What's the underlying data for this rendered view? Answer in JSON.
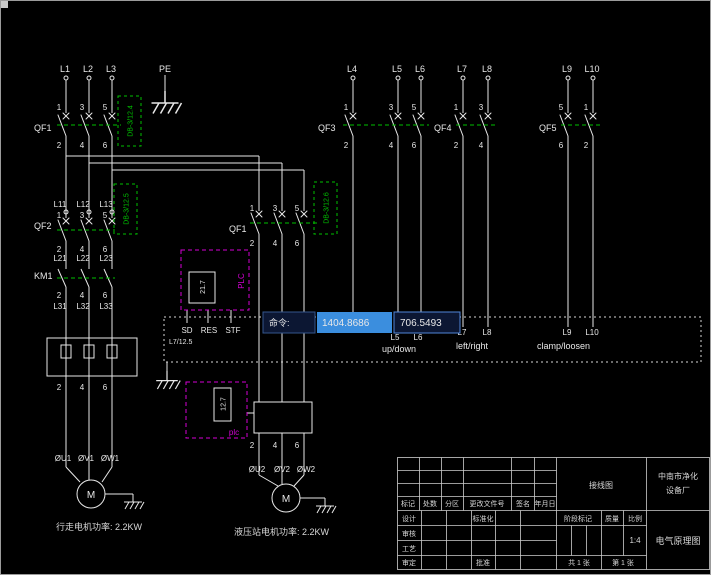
{
  "command": {
    "label": "命令:",
    "coord_x": "1404.8686",
    "coord_y": "706.5493"
  },
  "top_labels": {
    "l1": "L1",
    "l2": "L2",
    "l3": "L3",
    "pe": "PE",
    "l4": "L4",
    "l5": "L5",
    "l6": "L6",
    "l7": "L7",
    "l8": "L8",
    "l9": "L9",
    "l10": "L10"
  },
  "device_labels": {
    "qf1": "QF1",
    "qf2": "QF2",
    "qf3": "QF3",
    "qf4": "QF4",
    "qf5": "QF5",
    "km1": "KM1",
    "qf1_mid": "QF1"
  },
  "db_refs": {
    "db4": "DB-3/12.4",
    "db5": "DB-3/12.5",
    "db6": "DB-3/12.6"
  },
  "digits": {
    "d1": "1",
    "d2": "2",
    "d3": "3",
    "d4": "4",
    "d5": "5",
    "d6": "6"
  },
  "wire_labels": {
    "l11": "L11",
    "l12": "L12",
    "l13": "L13",
    "l21": "L21",
    "l22": "L22",
    "l23": "L23",
    "l31": "L31",
    "l32": "L32",
    "l33": "L33",
    "l5b": "L5",
    "l6b": "L6",
    "l7b": "L7",
    "l8b": "L8",
    "l9b": "L9",
    "l10b": "L10",
    "ref": "L7/12.5"
  },
  "plc": {
    "label_upper": "PLC",
    "num_upper": "21.7",
    "label_lower": "plc",
    "num_lower": "12.7",
    "t_sd": "SD",
    "t_res": "RES",
    "t_stf": "STF"
  },
  "actions": {
    "up_down": "up/down",
    "left_right": "left/right",
    "clamp_loosen": "clamp/loosen"
  },
  "motors": {
    "motor": "M",
    "u1": "ØU1",
    "v1": "ØV1",
    "w1": "ØW1",
    "u2": "ØU2",
    "v2": "ØV2",
    "w2": "ØW2",
    "caption1": "行走电机功率: 2.2KW",
    "caption2": "液压站电机功率: 2.2KW"
  },
  "title_block": {
    "rev_headers": {
      "mark": "标记",
      "count": "处数",
      "zone": "分区",
      "doc_no": "更改文件号",
      "sign": "签名",
      "date": "年月日"
    },
    "sign_labels": {
      "design": "设计",
      "check": "审核",
      "craft": "工艺",
      "examine": "审定",
      "standard": "标准化",
      "approve": "批准"
    },
    "stage": {
      "stage_mark": "阶段标记",
      "weight": "质量",
      "scale": "比例",
      "scale_value": "1:4",
      "total": "共 1 张",
      "sheet": "第 1 张"
    },
    "drawing_no": "接线图",
    "company_line1": "中南市净化",
    "company_line2": "设备厂",
    "title": "电气原理图"
  }
}
